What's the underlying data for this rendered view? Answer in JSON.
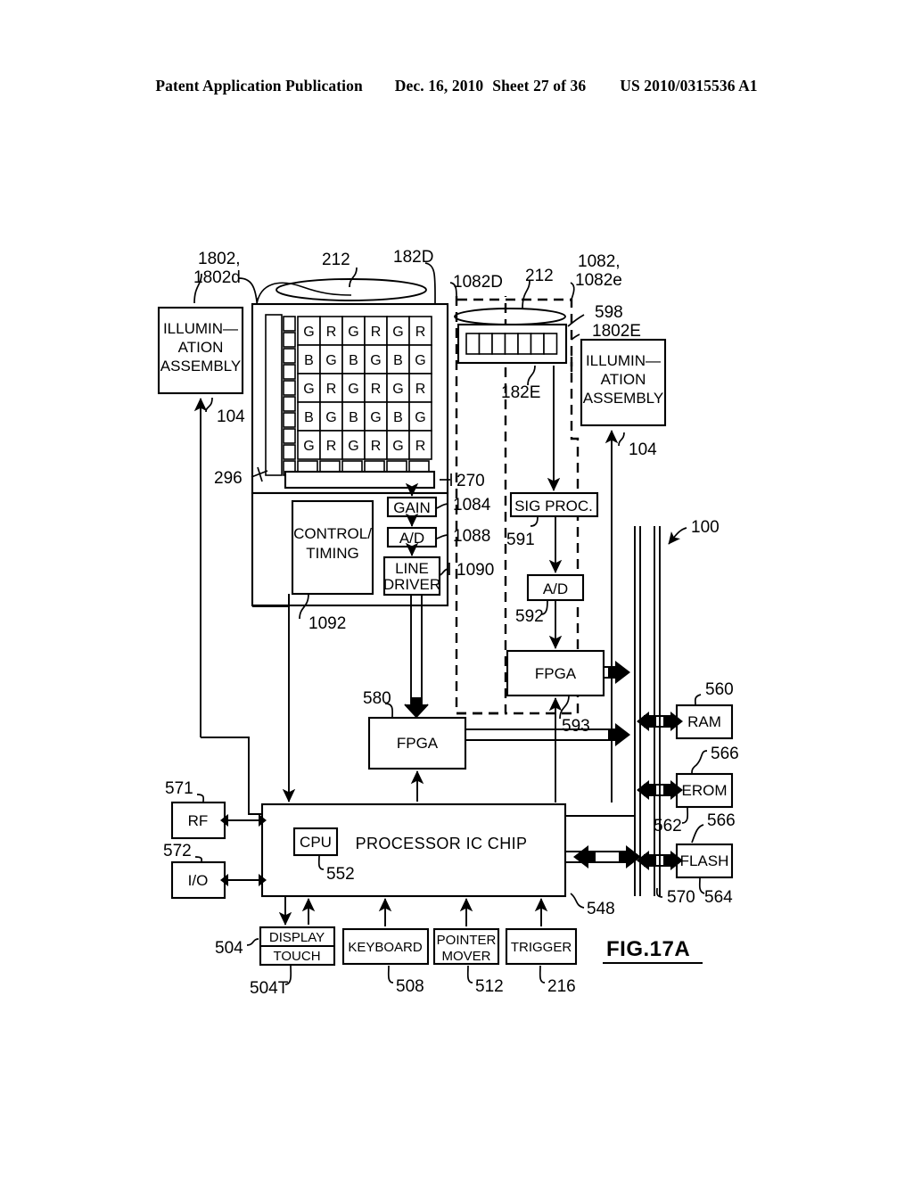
{
  "header": {
    "publication": "Patent Application Publication",
    "date": "Dec. 16, 2010",
    "sheet": "Sheet 27 of 36",
    "number": "US 2010/0315536 A1"
  },
  "figure": {
    "label": "FIG.17A"
  },
  "blocks": {
    "illumination_left": "ILLUMIN-\nATION\nASSEMBLY",
    "illumination_left_l1": "ILLUMIN—",
    "illumination_left_l2": "ATION",
    "illumination_left_l3": "ASSEMBLY",
    "illumination_right_l1": "ILLUMIN—",
    "illumination_right_l2": "ATION",
    "illumination_right_l3": "ASSEMBLY",
    "control_timing_l1": "CONTROL/",
    "control_timing_l2": "TIMING",
    "gain": "GAIN",
    "ad_left": "A/D",
    "line_driver_l1": "LINE",
    "line_driver_l2": "DRIVER",
    "sig_proc": "SIG  PROC.",
    "ad_right": "A/D",
    "fpga_right": "FPGA",
    "fpga_left": "FPGA",
    "processor": "PROCESSOR  IC  CHIP",
    "cpu": "CPU",
    "rf": "RF",
    "io": "I/O",
    "ram": "RAM",
    "erom": "EROM",
    "flash": "FLASH",
    "display": "DISPLAY",
    "touch": "TOUCH",
    "keyboard": "KEYBOARD",
    "pointer_mover_l1": "POINTER",
    "pointer_mover_l2": "MOVER",
    "trigger": "TRIGGER"
  },
  "reference_numerals": {
    "n1802": "1802,",
    "n1802d": "1802d",
    "n212a": "212",
    "n182D": "182D",
    "n1082D": "1082D",
    "n212b": "212",
    "n1082": "1082,",
    "n1082e": "1082e",
    "n598": "598",
    "n1802E": "1802E",
    "n104_left": "104",
    "n104_right": "104",
    "n296": "296",
    "n182E": "182E",
    "n270": "270",
    "n1084": "1084",
    "n1088": "1088",
    "n1090": "1090",
    "n1092": "1092",
    "n591": "591",
    "n592": "592",
    "n593": "593",
    "n100": "100",
    "n580": "580",
    "n560": "560",
    "n566a": "566",
    "n562": "562",
    "n566b": "566",
    "n564": "564",
    "n570": "570",
    "n548": "548",
    "n571": "571",
    "n572": "572",
    "n552": "552",
    "n504": "504",
    "n504T": "504T",
    "n508": "508",
    "n512": "512",
    "n216": "216"
  },
  "sensor_array": {
    "rows": [
      [
        "G",
        "R",
        "G",
        "R",
        "G",
        "R"
      ],
      [
        "B",
        "G",
        "B",
        "G",
        "B",
        "G"
      ],
      [
        "G",
        "R",
        "G",
        "R",
        "G",
        "R"
      ],
      [
        "B",
        "G",
        "B",
        "G",
        "B",
        "G"
      ],
      [
        "G",
        "R",
        "G",
        "R",
        "G",
        "R"
      ]
    ],
    "linear_array_cells": 7
  },
  "colors": {
    "ink": "#000000",
    "paper": "#ffffff"
  }
}
